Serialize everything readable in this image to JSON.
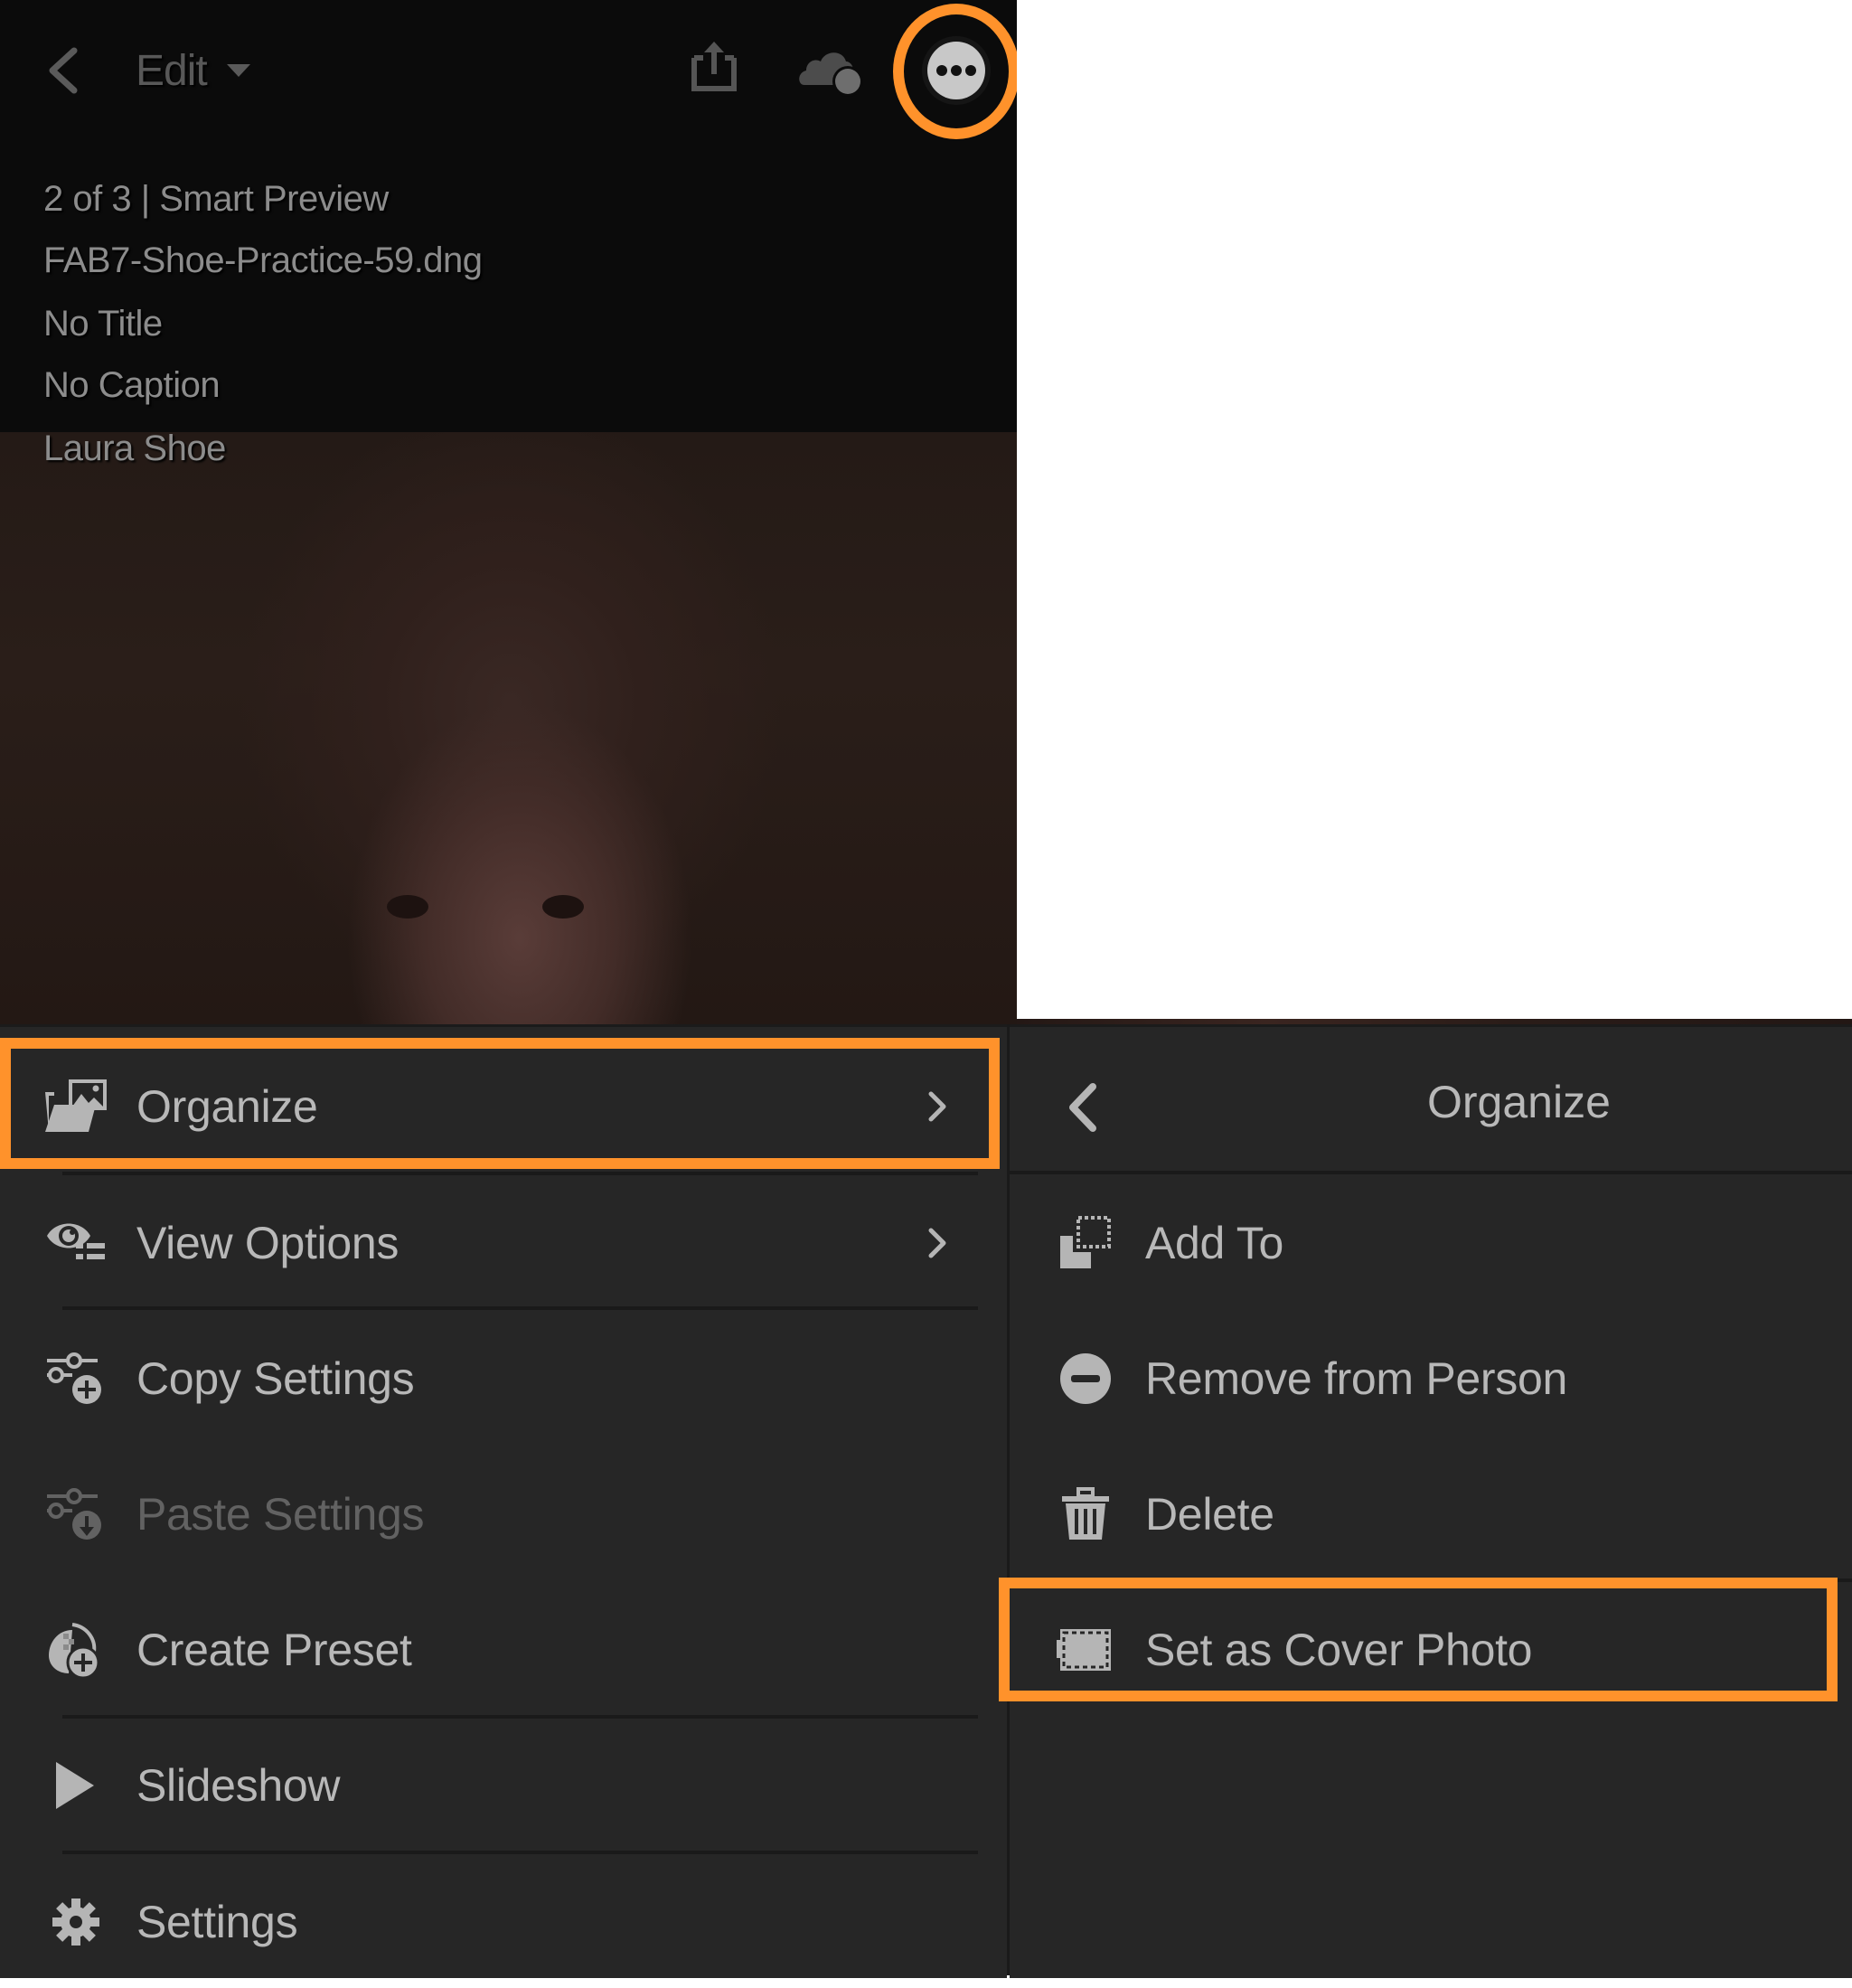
{
  "top_bar": {
    "back_icon": "chevron-left-icon",
    "mode_label": "Edit",
    "mode_dropdown_icon": "caret-down-icon",
    "share_icon": "share-icon",
    "cloud_icon": "cloud-sync-icon",
    "more_icon": "more-ellipsis-icon"
  },
  "photo_info": {
    "position_line": "2 of 3 | Smart Preview",
    "filename": "FAB7-Shoe-Practice-59.dng",
    "title": "No Title",
    "caption": "No Caption",
    "copyright": "Laura Shoe"
  },
  "main_menu": {
    "items": [
      {
        "label": "Organize",
        "icon": "organize-folder-icon",
        "has_submenu": true,
        "enabled": true,
        "highlighted": true
      },
      {
        "label": "View Options",
        "icon": "view-options-eye-icon",
        "has_submenu": true,
        "enabled": true
      },
      {
        "label": "Copy Settings",
        "icon": "copy-settings-icon",
        "has_submenu": false,
        "enabled": true
      },
      {
        "label": "Paste Settings",
        "icon": "paste-settings-icon",
        "has_submenu": false,
        "enabled": false
      },
      {
        "label": "Create Preset",
        "icon": "create-preset-icon",
        "has_submenu": false,
        "enabled": true
      },
      {
        "label": "Slideshow",
        "icon": "play-icon",
        "has_submenu": false,
        "enabled": true
      },
      {
        "label": "Settings",
        "icon": "gear-icon",
        "has_submenu": false,
        "enabled": true
      }
    ]
  },
  "organize_submenu": {
    "title": "Organize",
    "back_icon": "chevron-left-icon",
    "items": [
      {
        "label": "Add To",
        "icon": "add-to-album-icon"
      },
      {
        "label": "Remove from Person",
        "icon": "remove-circle-icon"
      },
      {
        "label": "Delete",
        "icon": "trash-icon"
      },
      {
        "label": "Set as Cover Photo",
        "icon": "cover-photo-icon",
        "highlighted": true
      }
    ]
  },
  "colors": {
    "highlight": "#ff922b",
    "menu_bg": "#262626",
    "viewer_bg": "#0b0b0b",
    "menu_text": "#b8b8b8",
    "disabled_text": "#626262"
  }
}
